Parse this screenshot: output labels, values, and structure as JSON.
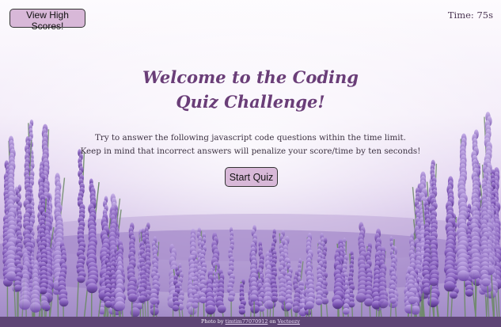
{
  "header": {
    "high_scores_label": "View High Scores!",
    "timer_text": "Time: 75s"
  },
  "main": {
    "title_line1": "Welcome to the Coding",
    "title_line2": "Quiz Challenge!",
    "intro_line1": "Try to answer the following javascript code questions within the time limit.",
    "intro_line2": "Keep in mind that incorrect answers will penalize your score/time by ten seconds!",
    "start_label": "Start Quiz"
  },
  "footer": {
    "prefix": "Photo by",
    "author": "timtim77070912",
    "middle": "on",
    "source": "Vecteezy"
  },
  "colors": {
    "button_bg": "#d8b8d8",
    "title": "#6a3e78",
    "footer_bg": "#5e4575"
  },
  "icons": [
    "lavender-field-background"
  ]
}
